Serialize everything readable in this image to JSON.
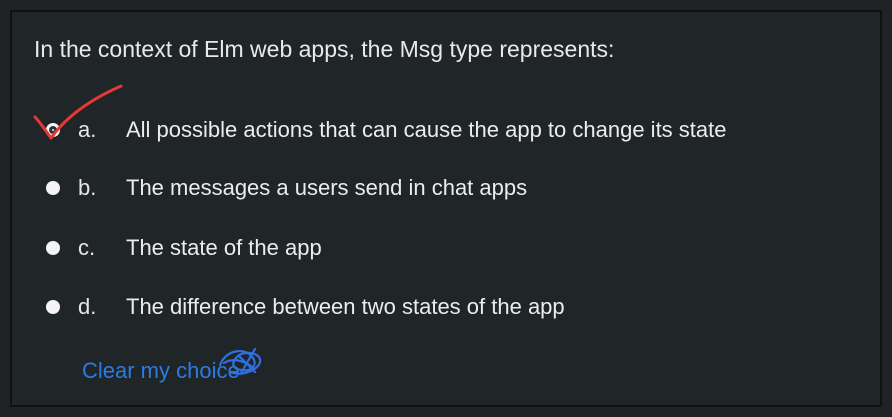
{
  "question": {
    "text": "In the context of Elm web apps, the Msg type represents:"
  },
  "options": [
    {
      "letter": "a.",
      "text": "All possible actions that can cause the app to change its state",
      "selected": true
    },
    {
      "letter": "b.",
      "text": "The messages a users send in chat apps",
      "selected": false
    },
    {
      "letter": "c.",
      "text": "The state of the app",
      "selected": false
    },
    {
      "letter": "d.",
      "text": "The difference between two states of the app",
      "selected": false
    }
  ],
  "clear_choice_label": "Clear my choice",
  "annotations": {
    "checkmark_color": "#e53935",
    "scribble_color": "#2f6fe0"
  },
  "colors": {
    "background": "#202528",
    "text": "#e6e6e6",
    "link": "#2c7be5"
  }
}
